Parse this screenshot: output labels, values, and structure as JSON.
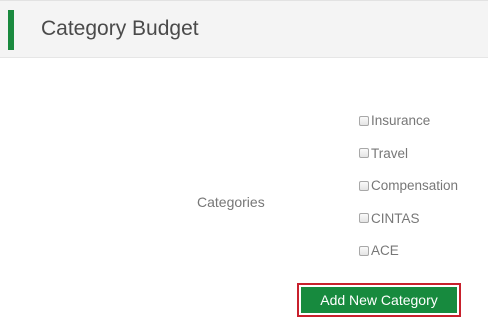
{
  "header": {
    "title": "Category Budget",
    "accent_color": "#1a8a3f"
  },
  "form": {
    "categories_label": "Categories",
    "categories": [
      {
        "label": "Insurance",
        "checked": false
      },
      {
        "label": "Travel",
        "checked": false
      },
      {
        "label": "Compensation",
        "checked": false
      },
      {
        "label": "CINTAS",
        "checked": false
      },
      {
        "label": "ACE",
        "checked": false
      }
    ]
  },
  "actions": {
    "add_new_category_label": "Add New Category",
    "button_color": "#178a3e",
    "highlight_color": "#c8202c"
  }
}
